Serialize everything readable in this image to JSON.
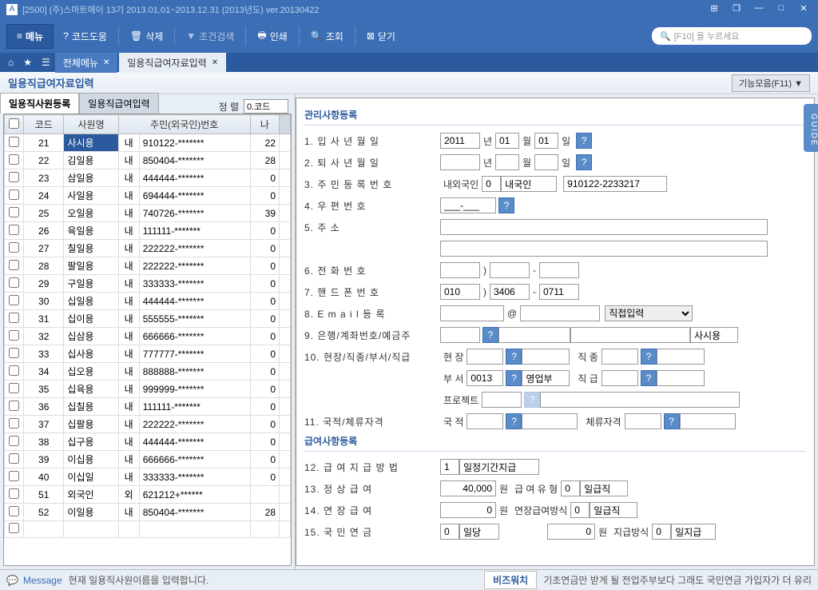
{
  "title_bar": "[2500] (주)스마트에이  13기 2013.01.01~2013.12.31 (2013년도)  ver.20130422",
  "toolbar": {
    "menu": "메뉴",
    "code_help": "코드도움",
    "delete": "삭제",
    "cond_search": "조건검색",
    "print": "인쇄",
    "lookup": "조회",
    "close": "닫기",
    "search_placeholder": "[F10] 을 누르세요"
  },
  "tabs": {
    "all_menu": "전체메뉴",
    "current": "일용직급여자료입력"
  },
  "page_title": "일용직급여자료입력",
  "func_btn": "기능모음(F11) ▼",
  "sub_tabs": {
    "emp_reg": "일용직사원등록",
    "pay_input": "일용직급여입력"
  },
  "sort": {
    "label": "정        렬",
    "value": "0.코드"
  },
  "grid_headers": {
    "chk": "",
    "code": "코드",
    "name": "사원명",
    "ssn": "주민(외국인)번호",
    "age": "나"
  },
  "rows": [
    {
      "code": "21",
      "name": "사시용",
      "fk": "내",
      "ssn": "910122-*******",
      "age": "22"
    },
    {
      "code": "22",
      "name": "김일용",
      "fk": "내",
      "ssn": "850404-*******",
      "age": "28"
    },
    {
      "code": "23",
      "name": "삼일용",
      "fk": "내",
      "ssn": "444444-*******",
      "age": "0"
    },
    {
      "code": "24",
      "name": "사일용",
      "fk": "내",
      "ssn": "694444-*******",
      "age": "0"
    },
    {
      "code": "25",
      "name": "오일용",
      "fk": "내",
      "ssn": "740726-*******",
      "age": "39"
    },
    {
      "code": "26",
      "name": "육일용",
      "fk": "내",
      "ssn": "111111-*******",
      "age": "0"
    },
    {
      "code": "27",
      "name": "칠일용",
      "fk": "내",
      "ssn": "222222-*******",
      "age": "0"
    },
    {
      "code": "28",
      "name": "팔일용",
      "fk": "내",
      "ssn": "222222-*******",
      "age": "0"
    },
    {
      "code": "29",
      "name": "구일용",
      "fk": "내",
      "ssn": "333333-*******",
      "age": "0"
    },
    {
      "code": "30",
      "name": "십일용",
      "fk": "내",
      "ssn": "444444-*******",
      "age": "0"
    },
    {
      "code": "31",
      "name": "십이용",
      "fk": "내",
      "ssn": "555555-*******",
      "age": "0"
    },
    {
      "code": "32",
      "name": "십삼용",
      "fk": "내",
      "ssn": "666666-*******",
      "age": "0"
    },
    {
      "code": "33",
      "name": "십사용",
      "fk": "내",
      "ssn": "777777-*******",
      "age": "0"
    },
    {
      "code": "34",
      "name": "십오용",
      "fk": "내",
      "ssn": "888888-*******",
      "age": "0"
    },
    {
      "code": "35",
      "name": "십육용",
      "fk": "내",
      "ssn": "999999-*******",
      "age": "0"
    },
    {
      "code": "36",
      "name": "십칠용",
      "fk": "내",
      "ssn": "111111-*******",
      "age": "0"
    },
    {
      "code": "37",
      "name": "십팔용",
      "fk": "내",
      "ssn": "222222-*******",
      "age": "0"
    },
    {
      "code": "38",
      "name": "십구용",
      "fk": "내",
      "ssn": "444444-*******",
      "age": "0"
    },
    {
      "code": "39",
      "name": "이십용",
      "fk": "내",
      "ssn": "666666-*******",
      "age": "0"
    },
    {
      "code": "40",
      "name": "이십일",
      "fk": "내",
      "ssn": "333333-*******",
      "age": "0"
    },
    {
      "code": "51",
      "name": "외국인",
      "fk": "외",
      "ssn": "621212+******",
      "age": ""
    },
    {
      "code": "52",
      "name": "이일용",
      "fk": "내",
      "ssn": "850404-*******",
      "age": "28"
    }
  ],
  "sec1": "관리사항등록",
  "sec2": "급여사항등록",
  "f": {
    "l1": "1. 입  사  년  월  일",
    "y": "2011",
    "yu": "년",
    "m": "01",
    "mu": "월",
    "d": "01",
    "du": "일",
    "l2": "2. 퇴  사  년  월  일",
    "l3": "3. 주  민  등  록  번  호",
    "l3a": "내외국인",
    "l3v": "0",
    "l3b": "내국인",
    "l3c": "910122-2233217",
    "l4": "4. 우   편   번   호",
    "l4v": "___-___",
    "l5": "5. 주               소",
    "l6": "6. 전   화   번   호",
    "l7": "7. 핸  드  폰  번  호",
    "p1": "010",
    "p2": "3406",
    "p3": "0711",
    "l8": "8. E  m  a  i  l  등  록",
    "at": "@",
    "email_type": "직접입력",
    "l9": "9. 은행/계좌번호/예금주",
    "owner": "사시용",
    "l10": "10. 현장/직종/부서/직급",
    "site": "현     장",
    "jobt": "직     종",
    "dept": "부     서",
    "deptv": "0013",
    "deptn": "영업부",
    "rank": "직     급",
    "proj": "프로젝트",
    "l11": "11. 국적/체류자격",
    "nat": "국     적",
    "stay": "체류자격",
    "l12": "12. 급  여  지  급  방  법",
    "v12": "1",
    "t12": "일정기간지급",
    "l13": "13. 정   상   급   여",
    "v13": "40,000",
    "u13": "원",
    "l13b": "급 여 유 형",
    "v13b": "0",
    "t13b": "일급직",
    "l14": "14. 연   장   급   여",
    "v14": "0",
    "u14": "원",
    "l14b": "연장급여방식",
    "v14b": "0",
    "t14b": "일급직",
    "l15": "15. 국   민   연   금",
    "v15": "0",
    "t15": "일당",
    "v15b": "0",
    "u15b": "원",
    "l15c": "지급방식",
    "v15c": "0",
    "t15c": "일지급"
  },
  "guide": "GUIDE",
  "footer": {
    "msg_label": "Message",
    "msg": "현재 일용직사원이름을 입력합니다.",
    "biz": "비즈워치",
    "news": "기초연금만 받게 될 전업주부보다 그래도 국민연금 가입자가 더 유리"
  }
}
